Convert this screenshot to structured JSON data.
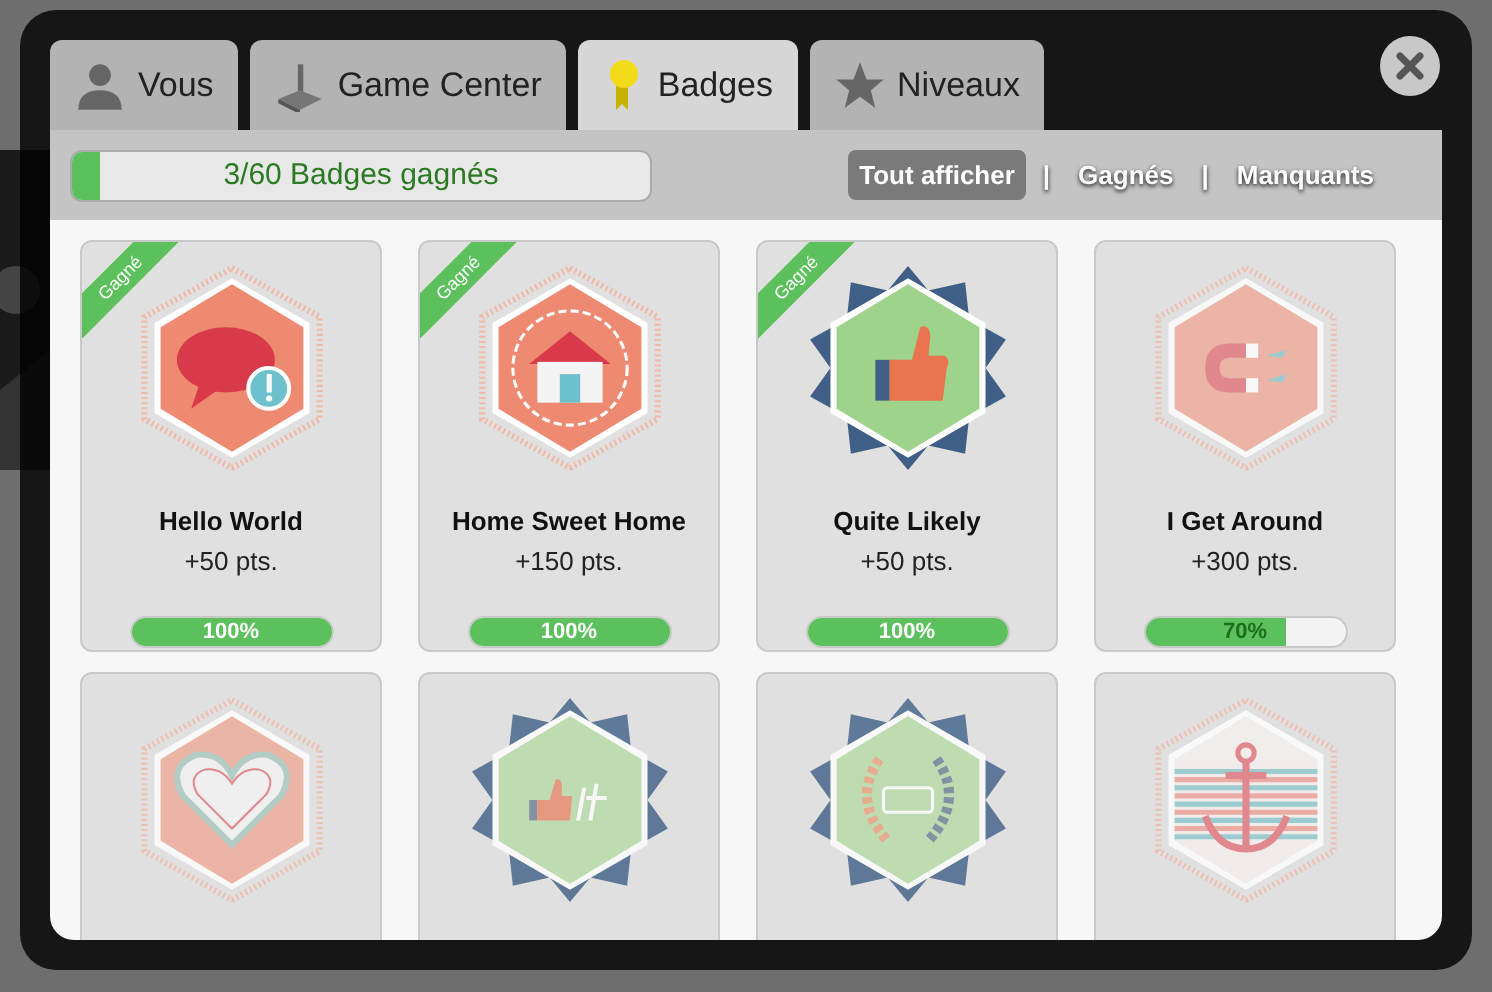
{
  "tabs": [
    {
      "label": "Vous",
      "selected": false
    },
    {
      "label": "Game Center",
      "selected": false
    },
    {
      "label": "Badges",
      "selected": true
    },
    {
      "label": "Niveaux",
      "selected": false
    }
  ],
  "progress": {
    "label": "3/60 Badges gagnés",
    "level": 0.05
  },
  "filters": [
    {
      "label": "Tout afficher",
      "selected": true
    },
    {
      "label": "Gagnés",
      "selected": false
    },
    {
      "label": "Manquants",
      "selected": false
    }
  ],
  "filter_separator": "|",
  "badges": [
    {
      "kind": "hello",
      "earned": true,
      "ribbon": "Gagné",
      "name": "Hello World",
      "points": "+50 pts.",
      "progress_label": "100%",
      "level": 1
    },
    {
      "kind": "home",
      "earned": true,
      "ribbon": "Gagné",
      "name": "Home Sweet Home",
      "points": "+150 pts.",
      "progress_label": "100%",
      "level": 1
    },
    {
      "kind": "thumb",
      "earned": true,
      "ribbon": "Gagné",
      "name": "Quite Likely",
      "points": "+50 pts.",
      "progress_label": "100%",
      "level": 1
    },
    {
      "kind": "magnet",
      "earned": false,
      "name": "I Get Around",
      "points": "+300 pts.",
      "progress_label": "70%",
      "level": 0.7
    },
    {
      "kind": "heart",
      "earned": false
    },
    {
      "kind": "likeit",
      "earned": false
    },
    {
      "kind": "laurel",
      "earned": false
    },
    {
      "kind": "anchor",
      "earned": false
    }
  ]
}
